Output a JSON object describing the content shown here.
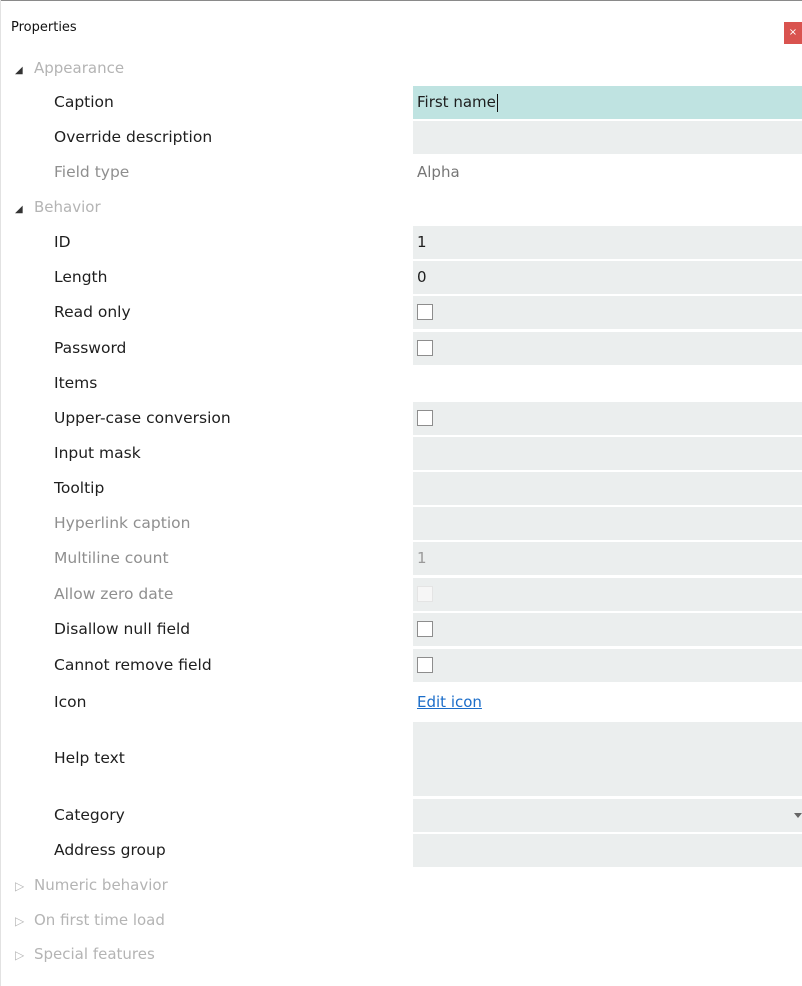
{
  "window": {
    "title": "Properties",
    "close_glyph": "×"
  },
  "sections": {
    "appearance": "Appearance",
    "behavior": "Behavior",
    "numeric_behavior": "Numeric behavior",
    "on_first_time_load": "On first time load",
    "special_features": "Special features"
  },
  "appearance": {
    "caption_label": "Caption",
    "caption_value": "First name",
    "override_description_label": "Override description",
    "override_description_value": "",
    "field_type_label": "Field type",
    "field_type_value": "Alpha"
  },
  "behavior": {
    "id_label": "ID",
    "id_value": "1",
    "length_label": "Length",
    "length_value": "0",
    "read_only_label": "Read only",
    "read_only_checked": false,
    "password_label": "Password",
    "password_checked": false,
    "items_label": "Items",
    "upper_case_label": "Upper-case conversion",
    "upper_case_checked": false,
    "input_mask_label": "Input mask",
    "input_mask_value": "",
    "tooltip_label": "Tooltip",
    "tooltip_value": "",
    "hyperlink_caption_label": "Hyperlink caption",
    "hyperlink_caption_value": "",
    "multiline_count_label": "Multiline count",
    "multiline_count_value": "1",
    "allow_zero_date_label": "Allow zero date",
    "allow_zero_date_checked": false,
    "disallow_null_label": "Disallow null field",
    "disallow_null_checked": false,
    "cannot_remove_label": "Cannot remove field",
    "cannot_remove_checked": false,
    "icon_label": "Icon",
    "icon_link": "Edit icon",
    "help_text_label": "Help text",
    "help_text_value": "",
    "category_label": "Category",
    "category_value": "",
    "address_group_label": "Address group",
    "address_group_value": ""
  },
  "icons": {
    "expanded": "expanded-triangle-icon",
    "collapsed": "collapsed-triangle-icon"
  }
}
